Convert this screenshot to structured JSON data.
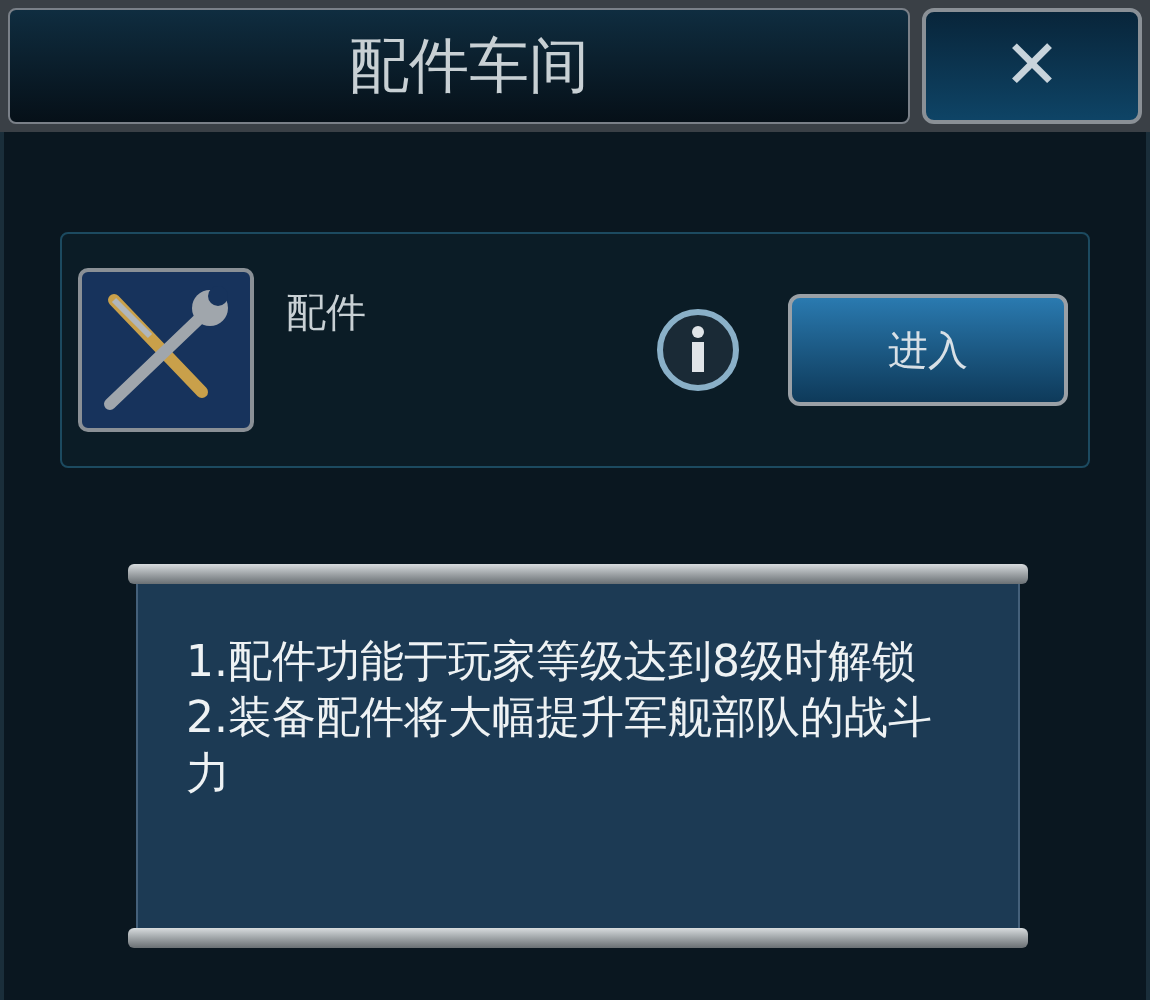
{
  "window": {
    "title": "配件车间",
    "close_label": "✕"
  },
  "feature": {
    "name": "配件",
    "enter_button": "进入"
  },
  "notes": [
    "1.配件功能于玩家等级达到8级时解锁",
    "2.装备配件将大幅提升军舰部队的战斗力"
  ]
}
